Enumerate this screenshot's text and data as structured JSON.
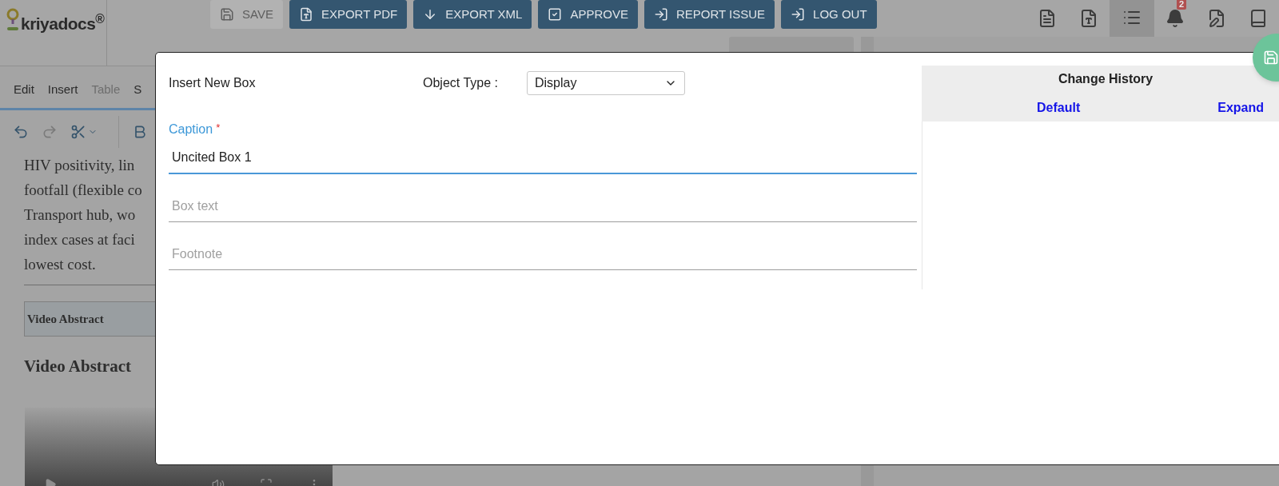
{
  "header": {
    "logo": "kriyadocs$^{®}$",
    "buttons": [
      {
        "label": "SAVE",
        "kind": "save",
        "disabled": true
      },
      {
        "label": "EXPORT PDF",
        "kind": "pdf",
        "disabled": false
      },
      {
        "label": "EXPORT XML",
        "kind": "download",
        "disabled": false
      },
      {
        "label": "APPROVE",
        "kind": "check",
        "disabled": false
      },
      {
        "label": "REPORT ISSUE",
        "kind": "enter",
        "disabled": false
      },
      {
        "label": "LOG OUT",
        "kind": "enter",
        "disabled": false
      }
    ],
    "icons": [
      {
        "kind": "word",
        "selected": false
      },
      {
        "kind": "pdf",
        "selected": false
      },
      {
        "kind": "list",
        "selected": true
      },
      {
        "kind": "bell",
        "selected": false,
        "badge": "2"
      },
      {
        "kind": "edit",
        "selected": false
      },
      {
        "kind": "book",
        "selected": false
      }
    ]
  },
  "menu": [
    {
      "label": "Edit",
      "disabled": false
    },
    {
      "label": "Insert",
      "disabled": false
    },
    {
      "label": "Table",
      "disabled": true
    },
    {
      "label": "S",
      "disabled": false
    }
  ],
  "document": {
    "lines": [
      "HIV positivity, lin",
      "footfall (flexible co",
      "Transport hub, wo",
      "index cases at faci",
      "lowest cost."
    ],
    "table_cell": "Video Abstract",
    "heading": "Video Abstract"
  },
  "modal": {
    "title": "Insert New Box",
    "object_type": {
      "label": "Object Type :",
      "value": "Display"
    },
    "fields": [
      {
        "label": "Caption",
        "required_mark": "*",
        "value": "Uncited Box 1",
        "focused": true
      },
      {
        "placeholder": "Box text",
        "focused": false
      },
      {
        "placeholder": "Footnote",
        "focused": false
      }
    ],
    "change_history": {
      "title": "Change History",
      "links": [
        "Default",
        "Expand"
      ]
    }
  }
}
